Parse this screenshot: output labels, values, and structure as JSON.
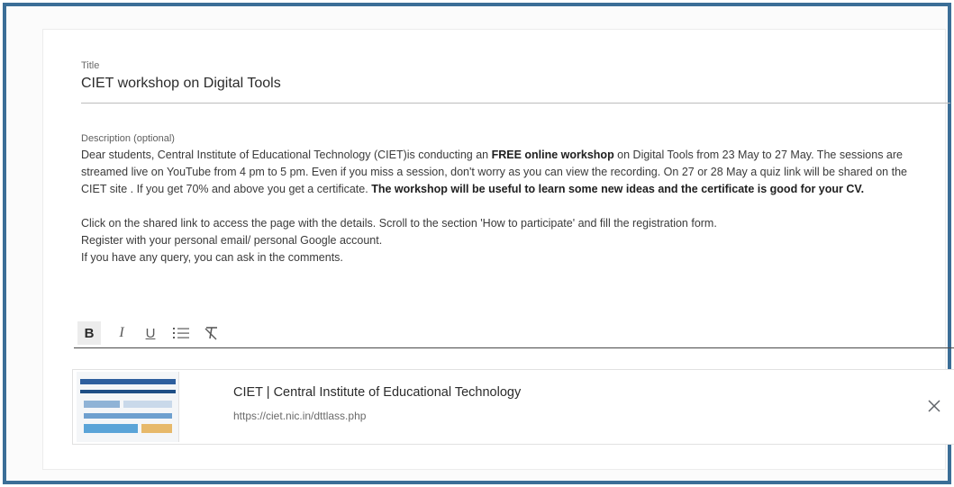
{
  "title_field": {
    "label": "Title",
    "value": "CIET workshop on Digital Tools"
  },
  "description_field": {
    "label": "Description (optional)",
    "p1_a": "Dear students, Central Institute of Educational Technology (CIET)is conducting an ",
    "p1_b": "FREE online workshop",
    "p1_c": " on Digital Tools from 23 May to 27 May. The sessions are streamed live on YouTube from 4 pm to 5 pm. Even if you miss a session, don't worry as  you can view the recording. On 27 or 28 May a quiz link will be shared  on the CIET site . If you get 70% and above you get a certificate. ",
    "p1_d": "The workshop will be useful to learn some new ideas and the certificate is good for your CV.",
    "p2": "Click on the shared link to access the page with the details. Scroll to the section 'How to participate' and fill the registration form.",
    "p3": "Register with your personal email/ personal Google account.",
    "p4": "If you have any query, you can ask in the comments."
  },
  "toolbar": {
    "bold": "B",
    "italic": "I",
    "underline": "U",
    "list_icon": "bulleted-list-icon",
    "clear_icon": "clear-formatting-icon"
  },
  "attachment": {
    "title": "CIET | Central Institute of Educational Technology",
    "url": "https://ciet.nic.in/dttlass.php",
    "close_icon": "close-icon"
  }
}
